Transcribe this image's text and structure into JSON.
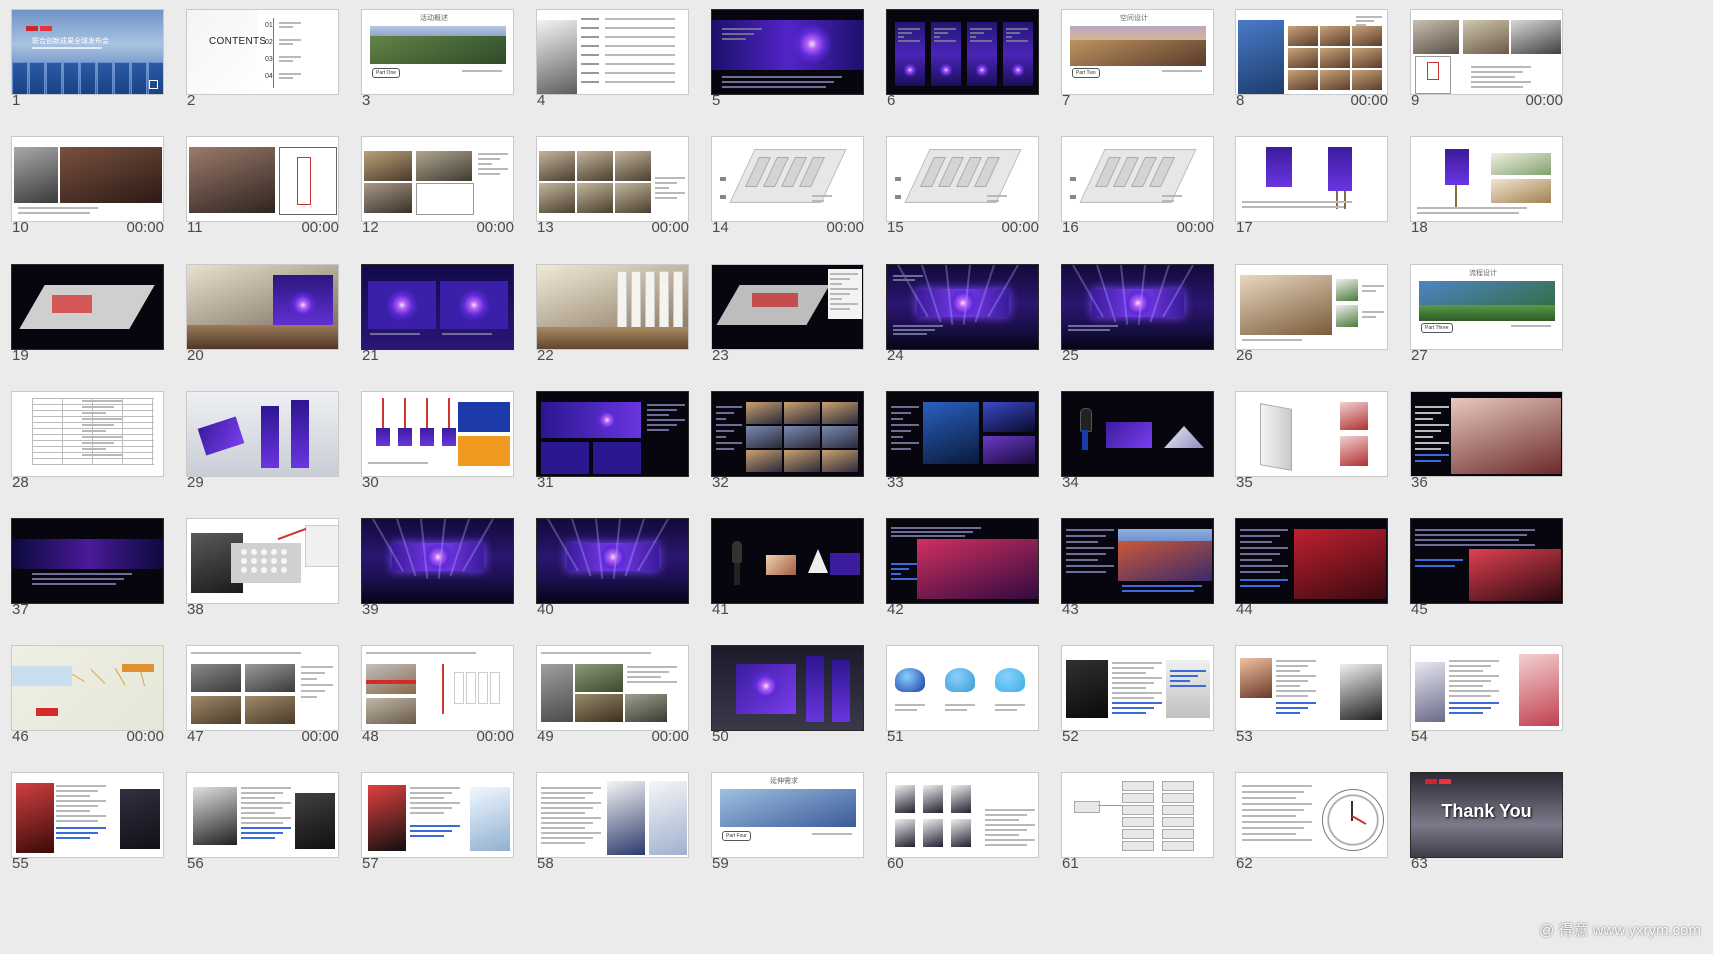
{
  "slides": [
    {
      "num": "1",
      "time": ""
    },
    {
      "num": "2",
      "time": ""
    },
    {
      "num": "3",
      "time": ""
    },
    {
      "num": "4",
      "time": ""
    },
    {
      "num": "5",
      "time": ""
    },
    {
      "num": "6",
      "time": ""
    },
    {
      "num": "7",
      "time": ""
    },
    {
      "num": "8",
      "time": "00:00"
    },
    {
      "num": "9",
      "time": "00:00"
    },
    {
      "num": "10",
      "time": "00:00"
    },
    {
      "num": "11",
      "time": "00:00"
    },
    {
      "num": "12",
      "time": "00:00"
    },
    {
      "num": "13",
      "time": "00:00"
    },
    {
      "num": "14",
      "time": "00:00"
    },
    {
      "num": "15",
      "time": "00:00"
    },
    {
      "num": "16",
      "time": "00:00"
    },
    {
      "num": "17",
      "time": ""
    },
    {
      "num": "18",
      "time": ""
    },
    {
      "num": "19",
      "time": ""
    },
    {
      "num": "20",
      "time": ""
    },
    {
      "num": "21",
      "time": ""
    },
    {
      "num": "22",
      "time": ""
    },
    {
      "num": "23",
      "time": ""
    },
    {
      "num": "24",
      "time": ""
    },
    {
      "num": "25",
      "time": ""
    },
    {
      "num": "26",
      "time": ""
    },
    {
      "num": "27",
      "time": ""
    },
    {
      "num": "28",
      "time": ""
    },
    {
      "num": "29",
      "time": ""
    },
    {
      "num": "30",
      "time": ""
    },
    {
      "num": "31",
      "time": ""
    },
    {
      "num": "32",
      "time": ""
    },
    {
      "num": "33",
      "time": ""
    },
    {
      "num": "34",
      "time": ""
    },
    {
      "num": "35",
      "time": ""
    },
    {
      "num": "36",
      "time": ""
    },
    {
      "num": "37",
      "time": ""
    },
    {
      "num": "38",
      "time": ""
    },
    {
      "num": "39",
      "time": ""
    },
    {
      "num": "40",
      "time": ""
    },
    {
      "num": "41",
      "time": ""
    },
    {
      "num": "42",
      "time": ""
    },
    {
      "num": "43",
      "time": ""
    },
    {
      "num": "44",
      "time": ""
    },
    {
      "num": "45",
      "time": ""
    },
    {
      "num": "46",
      "time": "00:00"
    },
    {
      "num": "47",
      "time": "00:00"
    },
    {
      "num": "48",
      "time": "00:00"
    },
    {
      "num": "49",
      "time": "00:00"
    },
    {
      "num": "50",
      "time": ""
    },
    {
      "num": "51",
      "time": ""
    },
    {
      "num": "52",
      "time": ""
    },
    {
      "num": "53",
      "time": ""
    },
    {
      "num": "54",
      "time": ""
    },
    {
      "num": "55",
      "time": ""
    },
    {
      "num": "56",
      "time": ""
    },
    {
      "num": "57",
      "time": ""
    },
    {
      "num": "58",
      "time": ""
    },
    {
      "num": "59",
      "time": ""
    },
    {
      "num": "60",
      "time": ""
    },
    {
      "num": "61",
      "time": ""
    },
    {
      "num": "62",
      "time": ""
    },
    {
      "num": "63",
      "time": ""
    }
  ],
  "thumb_text": {
    "contents_word": "CONTENTS",
    "contents_nums": [
      "01",
      "02",
      "03",
      "04"
    ],
    "part_one": "Part One",
    "part_two": "Part Two",
    "part_three": "Part Three",
    "part_four": "Part Four",
    "thank_you": "Thank You",
    "cover_title": "联合创新成果全球发布会",
    "section_titles": {
      "s3": "活动概述",
      "s7": "空间设计",
      "s27": "流程设计",
      "s59": "延伸需求"
    },
    "hat_icons": [
      "cap-icon",
      "cap-icon",
      "cap-icon"
    ]
  },
  "watermark": "@ 得意 www.yxrym.com",
  "colors": {
    "background": "#ebebeb",
    "dark_slide": "#07060e",
    "accent_purple": "#6a2bd9",
    "accent_blue": "#3d69d9",
    "accent_red": "#d42a2a"
  }
}
